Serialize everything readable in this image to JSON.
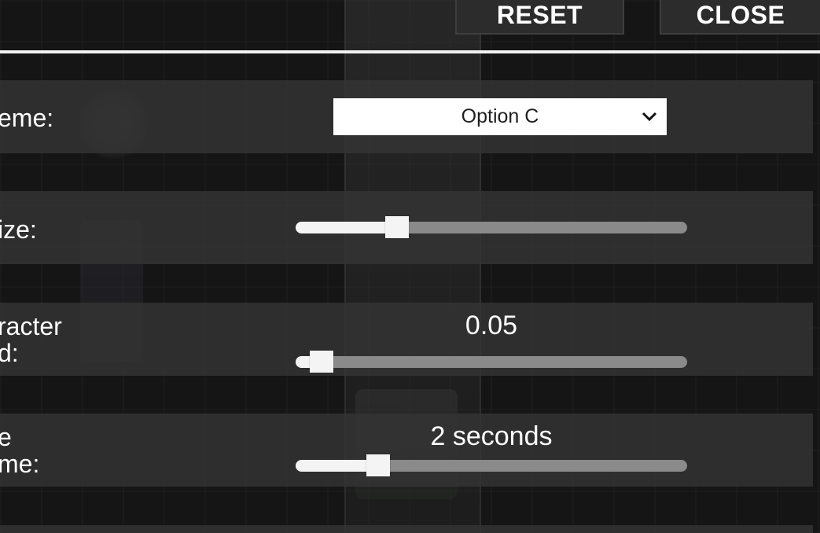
{
  "header": {
    "reset_label": "RESET",
    "close_label": "CLOSE"
  },
  "settings": [
    {
      "label": "eme:",
      "control": "dropdown",
      "selected": "Option C",
      "icon": "chevron-down-icon"
    },
    {
      "label": "ize:",
      "control": "slider",
      "value_fraction": 0.26
    },
    {
      "label": "racter\nd:",
      "control": "slider",
      "value_text": "0.05",
      "value_fraction": 0.067
    },
    {
      "label": "e\nme:",
      "control": "slider",
      "value_text": "2 seconds",
      "value_fraction": 0.21
    }
  ],
  "colors": {
    "background": "#151515",
    "row": "#343434",
    "divider": "#f2f2f2",
    "slider_track": "#8a8a8a",
    "slider_fill": "#f4f4f4",
    "button_bg": "#2c2c2c"
  }
}
